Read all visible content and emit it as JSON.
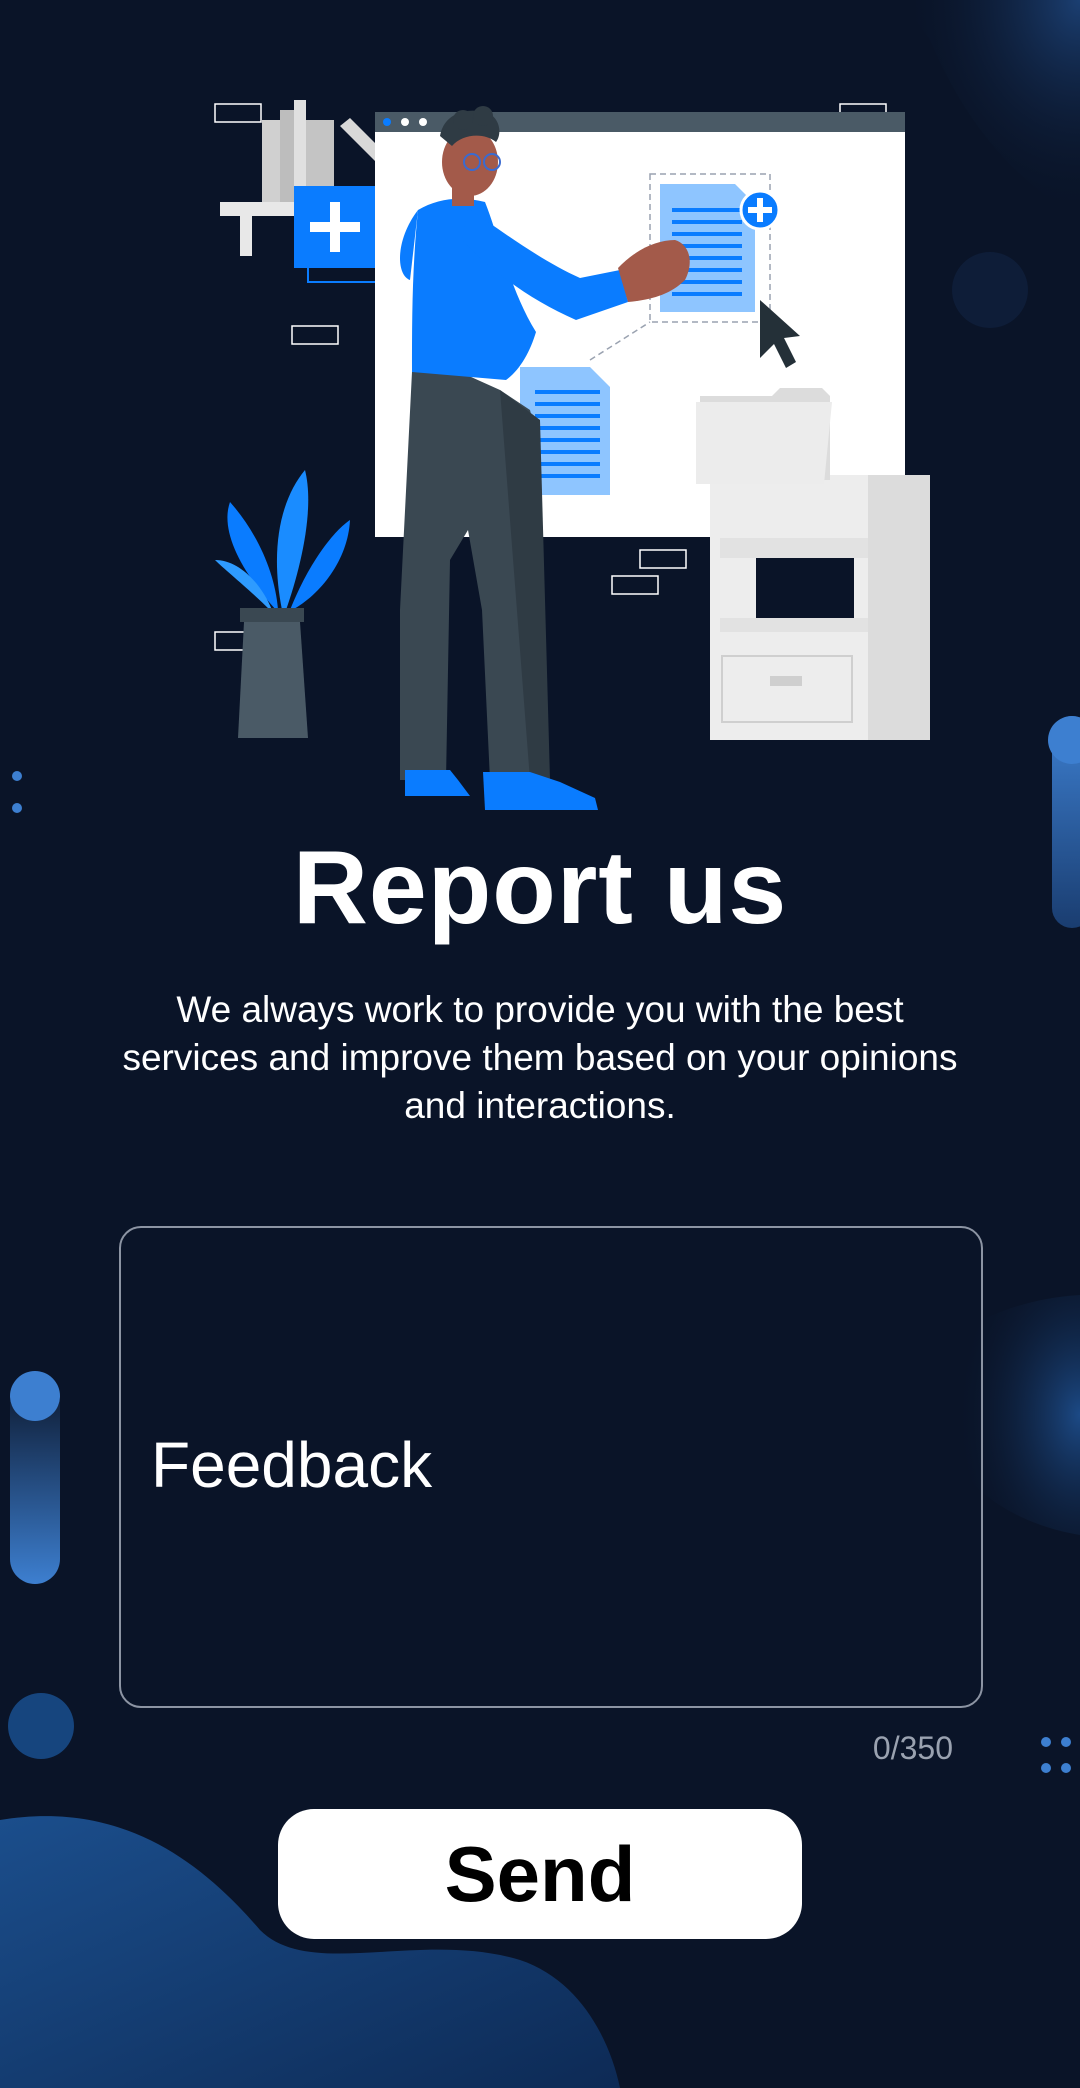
{
  "header": {
    "title": "Report us",
    "description": "We always work to provide you with the best services and improve them based on your opinions and interactions."
  },
  "feedback": {
    "placeholder": "Feedback",
    "value": "",
    "counter": "0/350"
  },
  "actions": {
    "send_label": "Send"
  },
  "colors": {
    "background": "#0a1428",
    "accent": "#0a7cff",
    "button_bg": "#ffffff",
    "button_text": "#000000"
  },
  "icons": {
    "illustration": "person-uploading-document-illustration",
    "plus": "plus-icon",
    "cursor": "cursor-icon",
    "folder": "folder-icon",
    "document": "document-icon",
    "plant": "plant-icon"
  }
}
